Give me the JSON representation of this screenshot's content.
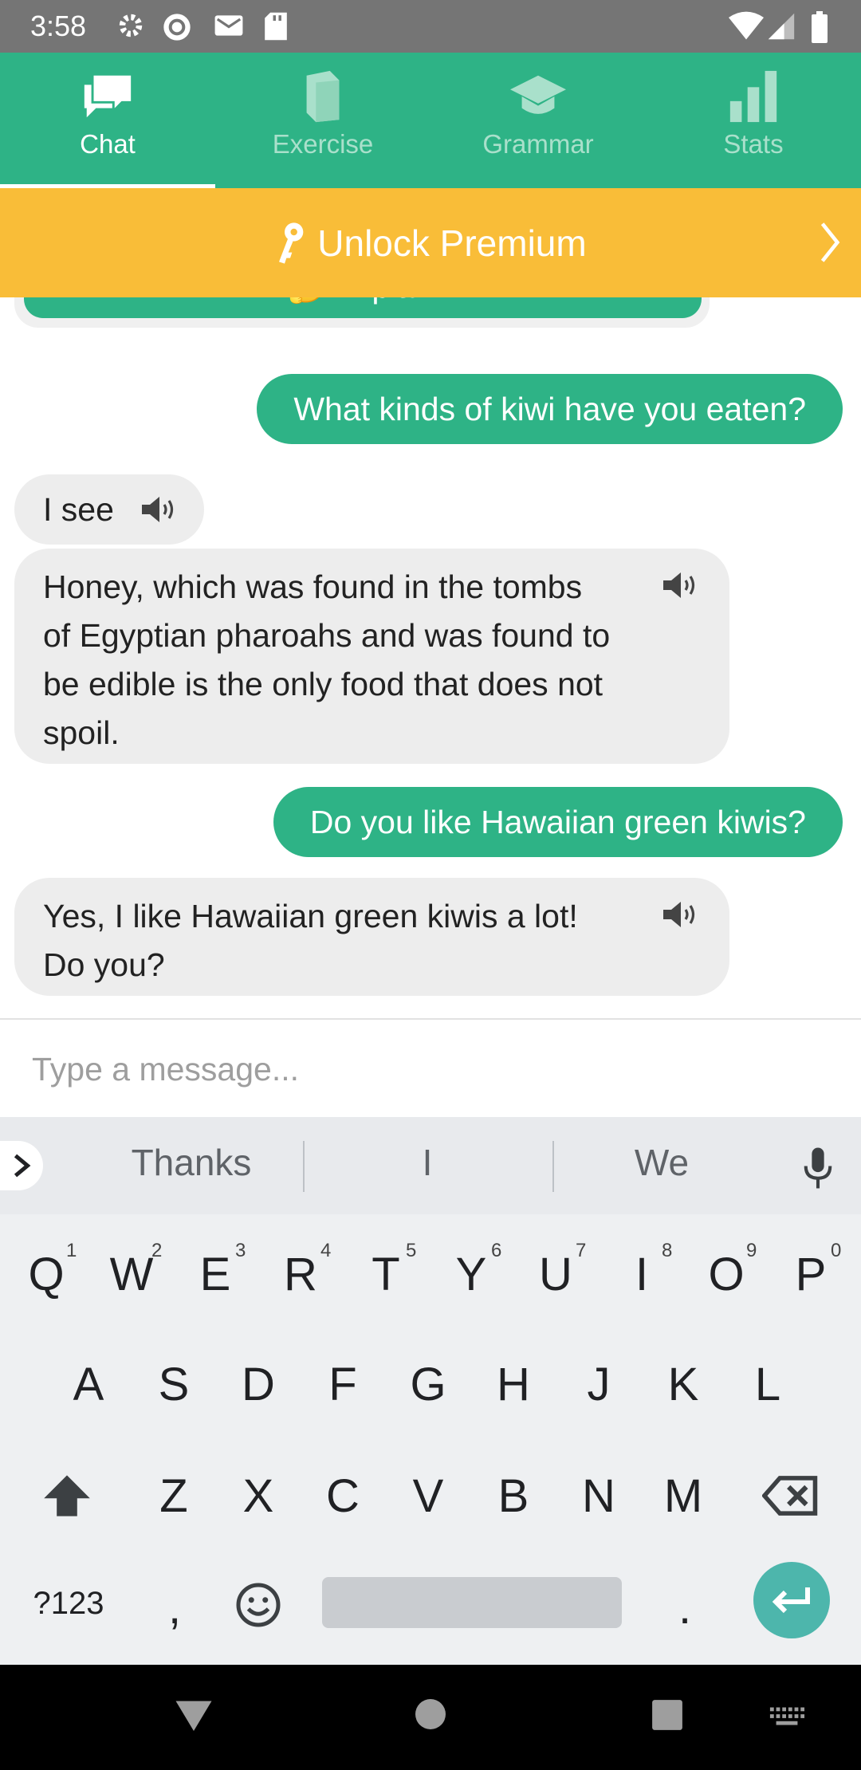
{
  "status_bar": {
    "time": "3:58"
  },
  "tabs": [
    {
      "label": "Chat",
      "icon": "chat-icon",
      "active": true
    },
    {
      "label": "Exercise",
      "icon": "book-icon",
      "active": false
    },
    {
      "label": "Grammar",
      "icon": "graduation-cap-icon",
      "active": false
    },
    {
      "label": "Stats",
      "icon": "bar-chart-icon",
      "active": false
    }
  ],
  "premium": {
    "label": "Unlock Premium"
  },
  "chat": {
    "explain_label": "🤔 Explain",
    "messages": [
      {
        "sender": "user",
        "text": "What kinds of kiwi have you eaten?"
      },
      {
        "sender": "bot",
        "text": "I see"
      },
      {
        "sender": "bot",
        "lines": [
          "Honey, which was found in the tombs",
          "of Egyptian pharoahs and was found to",
          "be edible is the only food that does not",
          "spoil."
        ]
      },
      {
        "sender": "user",
        "text": "Do you like Hawaiian green kiwis?"
      },
      {
        "sender": "bot",
        "lines": [
          "Yes, I like Hawaiian green kiwis a lot!",
          "Do you?"
        ]
      }
    ]
  },
  "input": {
    "placeholder": "Type a message..."
  },
  "keyboard": {
    "suggestions": [
      "Thanks",
      "I",
      "We"
    ],
    "row1": [
      "Q",
      "W",
      "E",
      "R",
      "T",
      "Y",
      "U",
      "I",
      "O",
      "P"
    ],
    "row1_hints": [
      "1",
      "2",
      "3",
      "4",
      "5",
      "6",
      "7",
      "8",
      "9",
      "0"
    ],
    "row2": [
      "A",
      "S",
      "D",
      "F",
      "G",
      "H",
      "J",
      "K",
      "L"
    ],
    "row3": [
      "Z",
      "X",
      "C",
      "V",
      "B",
      "N",
      "M"
    ],
    "symbols_label": "?123",
    "comma": ",",
    "period": "."
  },
  "colors": {
    "primary": "#2eb386",
    "premium": "#f9bd38",
    "bubble": "#ededed"
  }
}
